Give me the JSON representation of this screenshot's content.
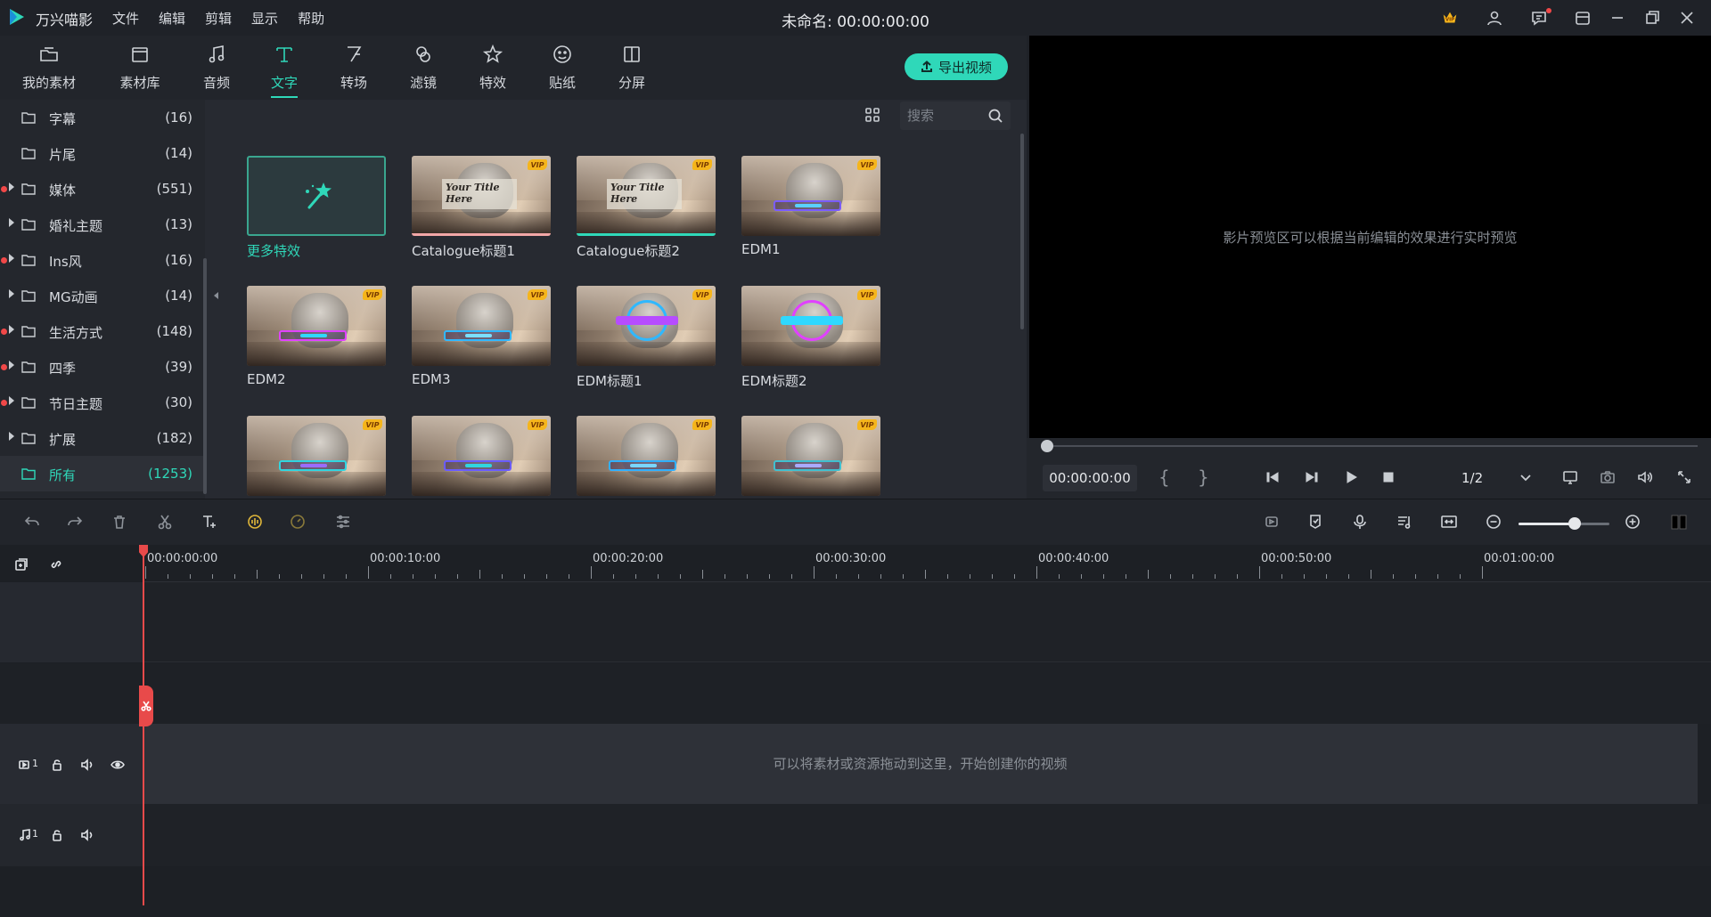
{
  "app": {
    "name": "万兴喵影",
    "doc_title": "未命名: 00:00:00:00",
    "menu": [
      "文件",
      "编辑",
      "剪辑",
      "显示",
      "帮助"
    ]
  },
  "tabs": [
    {
      "label": "我的素材",
      "icon": "folder-open-icon"
    },
    {
      "label": "素材库",
      "icon": "library-icon"
    },
    {
      "label": "音频",
      "icon": "music-note-icon"
    },
    {
      "label": "文字",
      "icon": "text-icon",
      "active": true
    },
    {
      "label": "转场",
      "icon": "transition-icon"
    },
    {
      "label": "滤镜",
      "icon": "filter-icon"
    },
    {
      "label": "特效",
      "icon": "effects-icon"
    },
    {
      "label": "贴纸",
      "icon": "sticker-icon"
    },
    {
      "label": "分屏",
      "icon": "split-screen-icon"
    }
  ],
  "export_label": "导出视频",
  "categories": [
    {
      "name": "字幕",
      "count": "(16)",
      "dot": false,
      "arrow": false
    },
    {
      "name": "片尾",
      "count": "(14)",
      "dot": false,
      "arrow": false
    },
    {
      "name": "媒体",
      "count": "(551)",
      "dot": true,
      "arrow": true
    },
    {
      "name": "婚礼主题",
      "count": "(13)",
      "dot": false,
      "arrow": true
    },
    {
      "name": "Ins风",
      "count": "(16)",
      "dot": true,
      "arrow": true
    },
    {
      "name": "MG动画",
      "count": "(14)",
      "dot": false,
      "arrow": true
    },
    {
      "name": "生活方式",
      "count": "(148)",
      "dot": true,
      "arrow": true
    },
    {
      "name": "四季",
      "count": "(39)",
      "dot": true,
      "arrow": true
    },
    {
      "name": "节日主题",
      "count": "(30)",
      "dot": true,
      "arrow": true
    },
    {
      "name": "扩展",
      "count": "(182)",
      "dot": false,
      "arrow": true
    },
    {
      "name": "所有",
      "count": "(1253)",
      "dot": false,
      "arrow": false,
      "active": true
    }
  ],
  "search": {
    "placeholder": "搜索"
  },
  "grid": [
    {
      "caption": "更多特效",
      "kind": "more"
    },
    {
      "caption": "Catalogue标题1",
      "kind": "catalogue",
      "overlay": "Your Title Here",
      "vip": "VIP"
    },
    {
      "caption": "Catalogue标题2",
      "kind": "catalogue2",
      "overlay": "Your Title Here",
      "vip": "VIP"
    },
    {
      "caption": "EDM1",
      "kind": "edm",
      "vip": "VIP"
    },
    {
      "caption": "EDM2",
      "kind": "edm2",
      "vip": "VIP"
    },
    {
      "caption": "EDM3",
      "kind": "edm3",
      "vip": "VIP"
    },
    {
      "caption": "EDM标题1",
      "kind": "edmring",
      "vip": "VIP"
    },
    {
      "caption": "EDM标题2",
      "kind": "edmring2",
      "vip": "VIP"
    },
    {
      "caption": "",
      "kind": "edm4",
      "vip": "VIP"
    },
    {
      "caption": "",
      "kind": "edm5",
      "vip": "VIP"
    },
    {
      "caption": "",
      "kind": "edm6",
      "vip": "VIP"
    },
    {
      "caption": "",
      "kind": "edm7",
      "vip": "VIP"
    }
  ],
  "preview": {
    "message": "影片预览区可以根据当前编辑的效果进行实时预览",
    "timecode": "00:00:00:00",
    "brace_open": "{",
    "brace_close": "}",
    "page": "1/2"
  },
  "ruler_labels": [
    "00:00:00:00",
    "00:00:10:00",
    "00:00:20:00",
    "00:00:30:00",
    "00:00:40:00",
    "00:00:50:00",
    "00:01:00:00"
  ],
  "timeline": {
    "drop_message": "可以将素材或资源拖动到这里，开始创建你的视频",
    "video_track_num": "1",
    "audio_track_num": "1"
  },
  "colors": {
    "accent": "#2fd8b9",
    "vip": "#f5b51c",
    "playhead": "#e84a4a"
  }
}
